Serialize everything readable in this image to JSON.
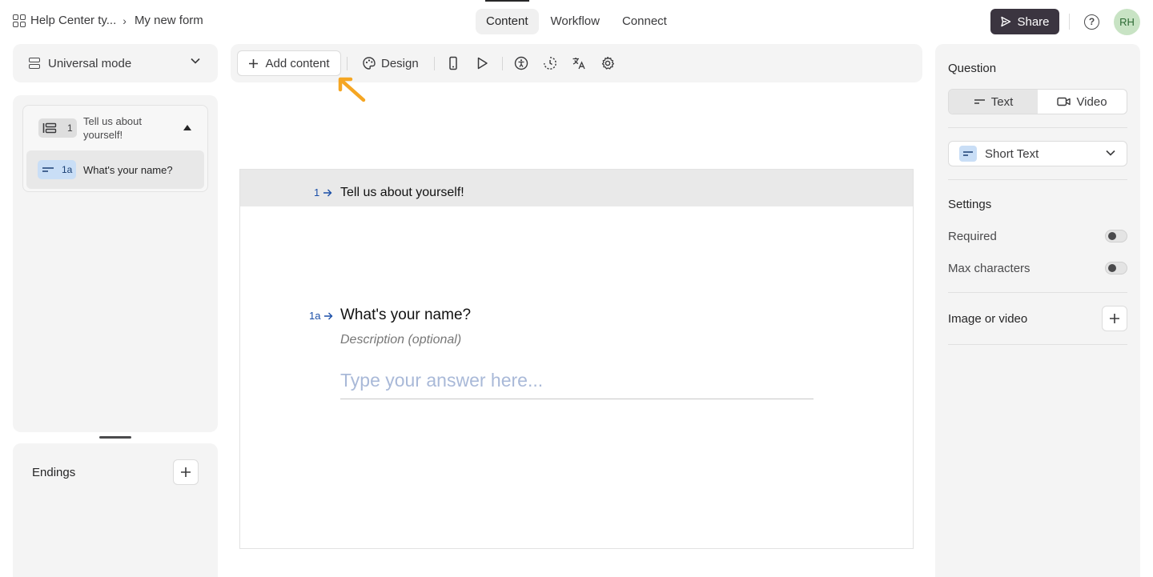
{
  "topbar": {
    "breadcrumb_workspace": "Help Center ty...",
    "breadcrumb_form": "My new form",
    "tabs": [
      {
        "label": "Content"
      },
      {
        "label": "Workflow"
      },
      {
        "label": "Connect"
      }
    ],
    "share_label": "Share",
    "help_label": "?",
    "avatar_initials": "RH"
  },
  "sidebar": {
    "mode_label": "Universal mode",
    "group": {
      "number": "1",
      "title": "Tell us about yourself!"
    },
    "question": {
      "number": "1a",
      "title": "What's your name?"
    },
    "endings_label": "Endings"
  },
  "toolbar": {
    "add_content_label": "Add content",
    "design_label": "Design",
    "icons": [
      "mobile-preview-icon",
      "play-icon",
      "accessibility-icon",
      "loading-icon",
      "translate-icon",
      "settings-icon"
    ]
  },
  "canvas": {
    "group_number": "1",
    "group_title": "Tell us about yourself!",
    "question_number": "1a",
    "question_title": "What's your name?",
    "description_placeholder": "Description (optional)",
    "answer_placeholder": "Type your answer here..."
  },
  "panel": {
    "question_heading": "Question",
    "type_options": [
      {
        "label": "Text"
      },
      {
        "label": "Video"
      }
    ],
    "answer_type": "Short Text",
    "settings_heading": "Settings",
    "required_label": "Required",
    "max_chars_label": "Max characters",
    "image_video_label": "Image or video"
  },
  "colors": {
    "accent_arrow": "#f5a623",
    "share_bg": "#3b3540",
    "number_blue": "#1b4fa8",
    "placeholder_blue": "#a9b9d8"
  }
}
